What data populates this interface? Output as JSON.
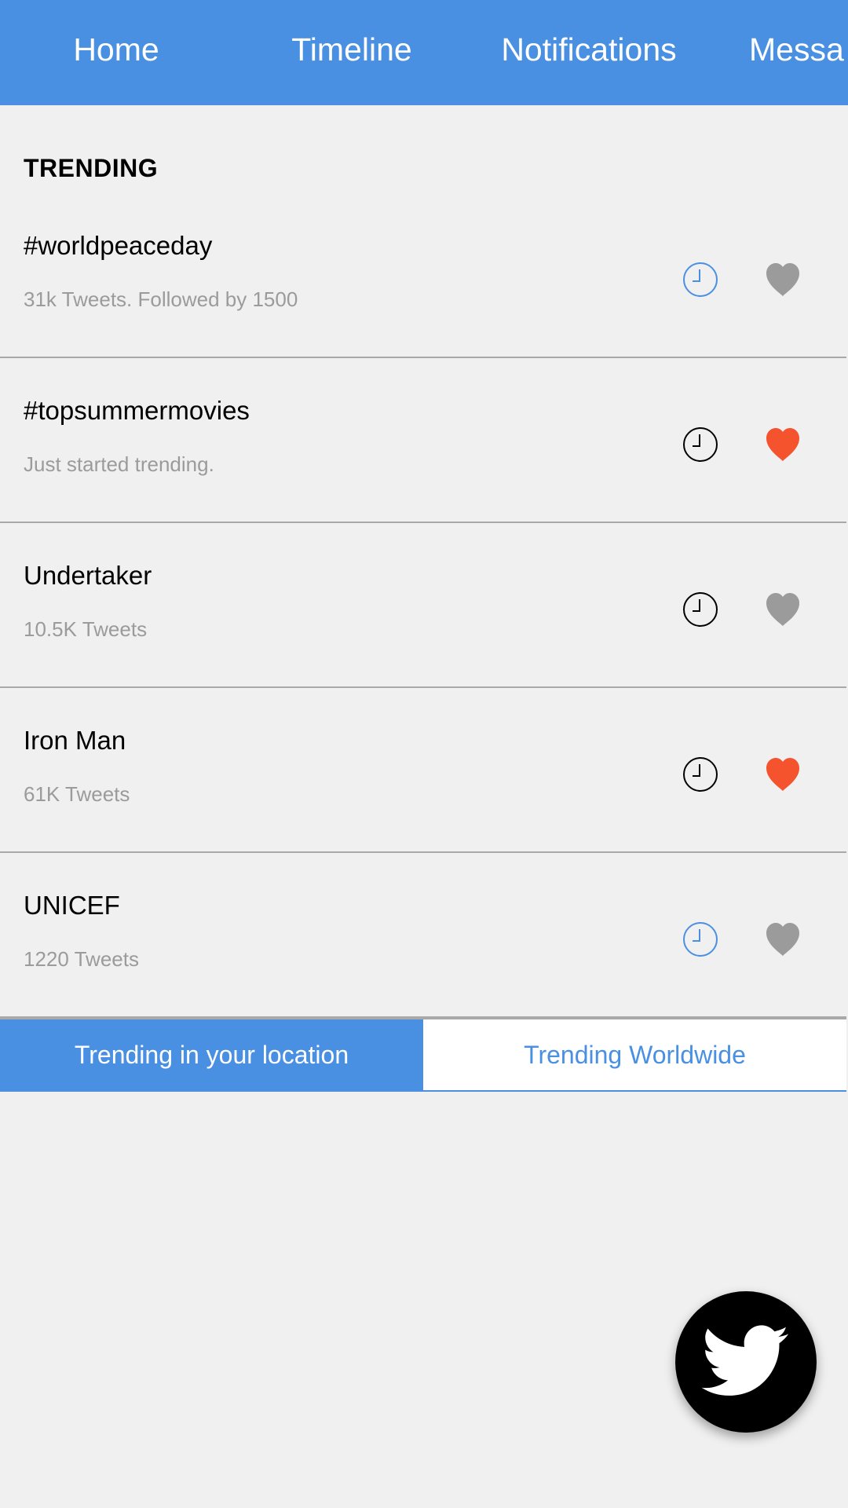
{
  "nav": {
    "tabs": [
      {
        "label": "Home"
      },
      {
        "label": "Timeline"
      },
      {
        "label": "Notifications"
      },
      {
        "label": "Messa"
      }
    ]
  },
  "section": {
    "title": "TRENDING"
  },
  "trends": [
    {
      "name": "#worldpeaceday",
      "sub": "31k Tweets. Followed by 1500",
      "clock": "clock-icon",
      "clock_active": true,
      "liked": false
    },
    {
      "name": "#topsummermovies",
      "sub": "Just started trending.",
      "clock": "clock-icon",
      "clock_active": false,
      "liked": true
    },
    {
      "name": "Undertaker",
      "sub": "10.5K Tweets",
      "clock": "clock-icon",
      "clock_active": false,
      "liked": false
    },
    {
      "name": "Iron Man",
      "sub": "61K Tweets",
      "clock": "clock-icon",
      "clock_active": false,
      "liked": true
    },
    {
      "name": "UNICEF",
      "sub": "1220 Tweets",
      "clock": "clock-icon",
      "clock_active": true,
      "liked": false
    }
  ],
  "bottom_tabs": [
    {
      "label": "Trending in your location",
      "active": true
    },
    {
      "label": "Trending Worldwide",
      "active": false
    }
  ],
  "fab": {
    "icon": "twitter-bird-icon"
  },
  "colors": {
    "accent": "#4a90e2",
    "liked": "#f5522e",
    "unliked": "#9b9b9b",
    "clock_active": "#4a90e2",
    "clock_default": "#000000",
    "background": "#f0f0f0"
  }
}
